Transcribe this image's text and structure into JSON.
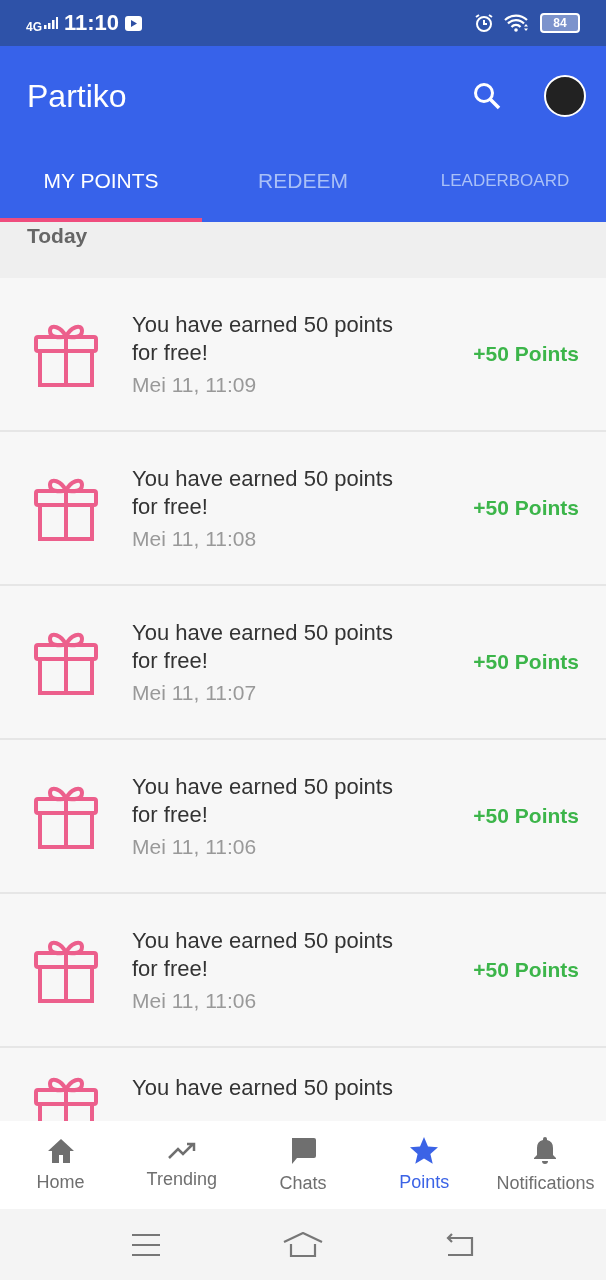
{
  "status_bar": {
    "network": "4G",
    "time": "11:10",
    "battery": "84"
  },
  "app_bar": {
    "title": "Partiko"
  },
  "tabs": [
    {
      "label": "MY POINTS",
      "selected": true
    },
    {
      "label": "REDEEM",
      "selected": false
    },
    {
      "label": "LEADERBOARD",
      "selected": false
    }
  ],
  "section": "Today",
  "entries": [
    {
      "message": "You have earned 50 points for free!",
      "time": "Mei 11, 11:09",
      "points": "+50 Points"
    },
    {
      "message": "You have earned 50 points for free!",
      "time": "Mei 11, 11:08",
      "points": "+50 Points"
    },
    {
      "message": "You have earned 50 points for free!",
      "time": "Mei 11, 11:07",
      "points": "+50 Points"
    },
    {
      "message": "You have earned 50 points for free!",
      "time": "Mei 11, 11:06",
      "points": "+50 Points"
    },
    {
      "message": "You have earned 50 points for free!",
      "time": "Mei 11, 11:06",
      "points": "+50 Points"
    },
    {
      "message": "You have earned 50 points"
    }
  ],
  "bottom_nav": [
    {
      "kind": "home",
      "label": "Home",
      "selected": false
    },
    {
      "kind": "trending",
      "label": "Trending",
      "selected": false
    },
    {
      "kind": "chats",
      "label": "Chats",
      "selected": false
    },
    {
      "kind": "points",
      "label": "Points",
      "selected": true
    },
    {
      "kind": "notifications",
      "label": "Notifications",
      "selected": false
    }
  ]
}
